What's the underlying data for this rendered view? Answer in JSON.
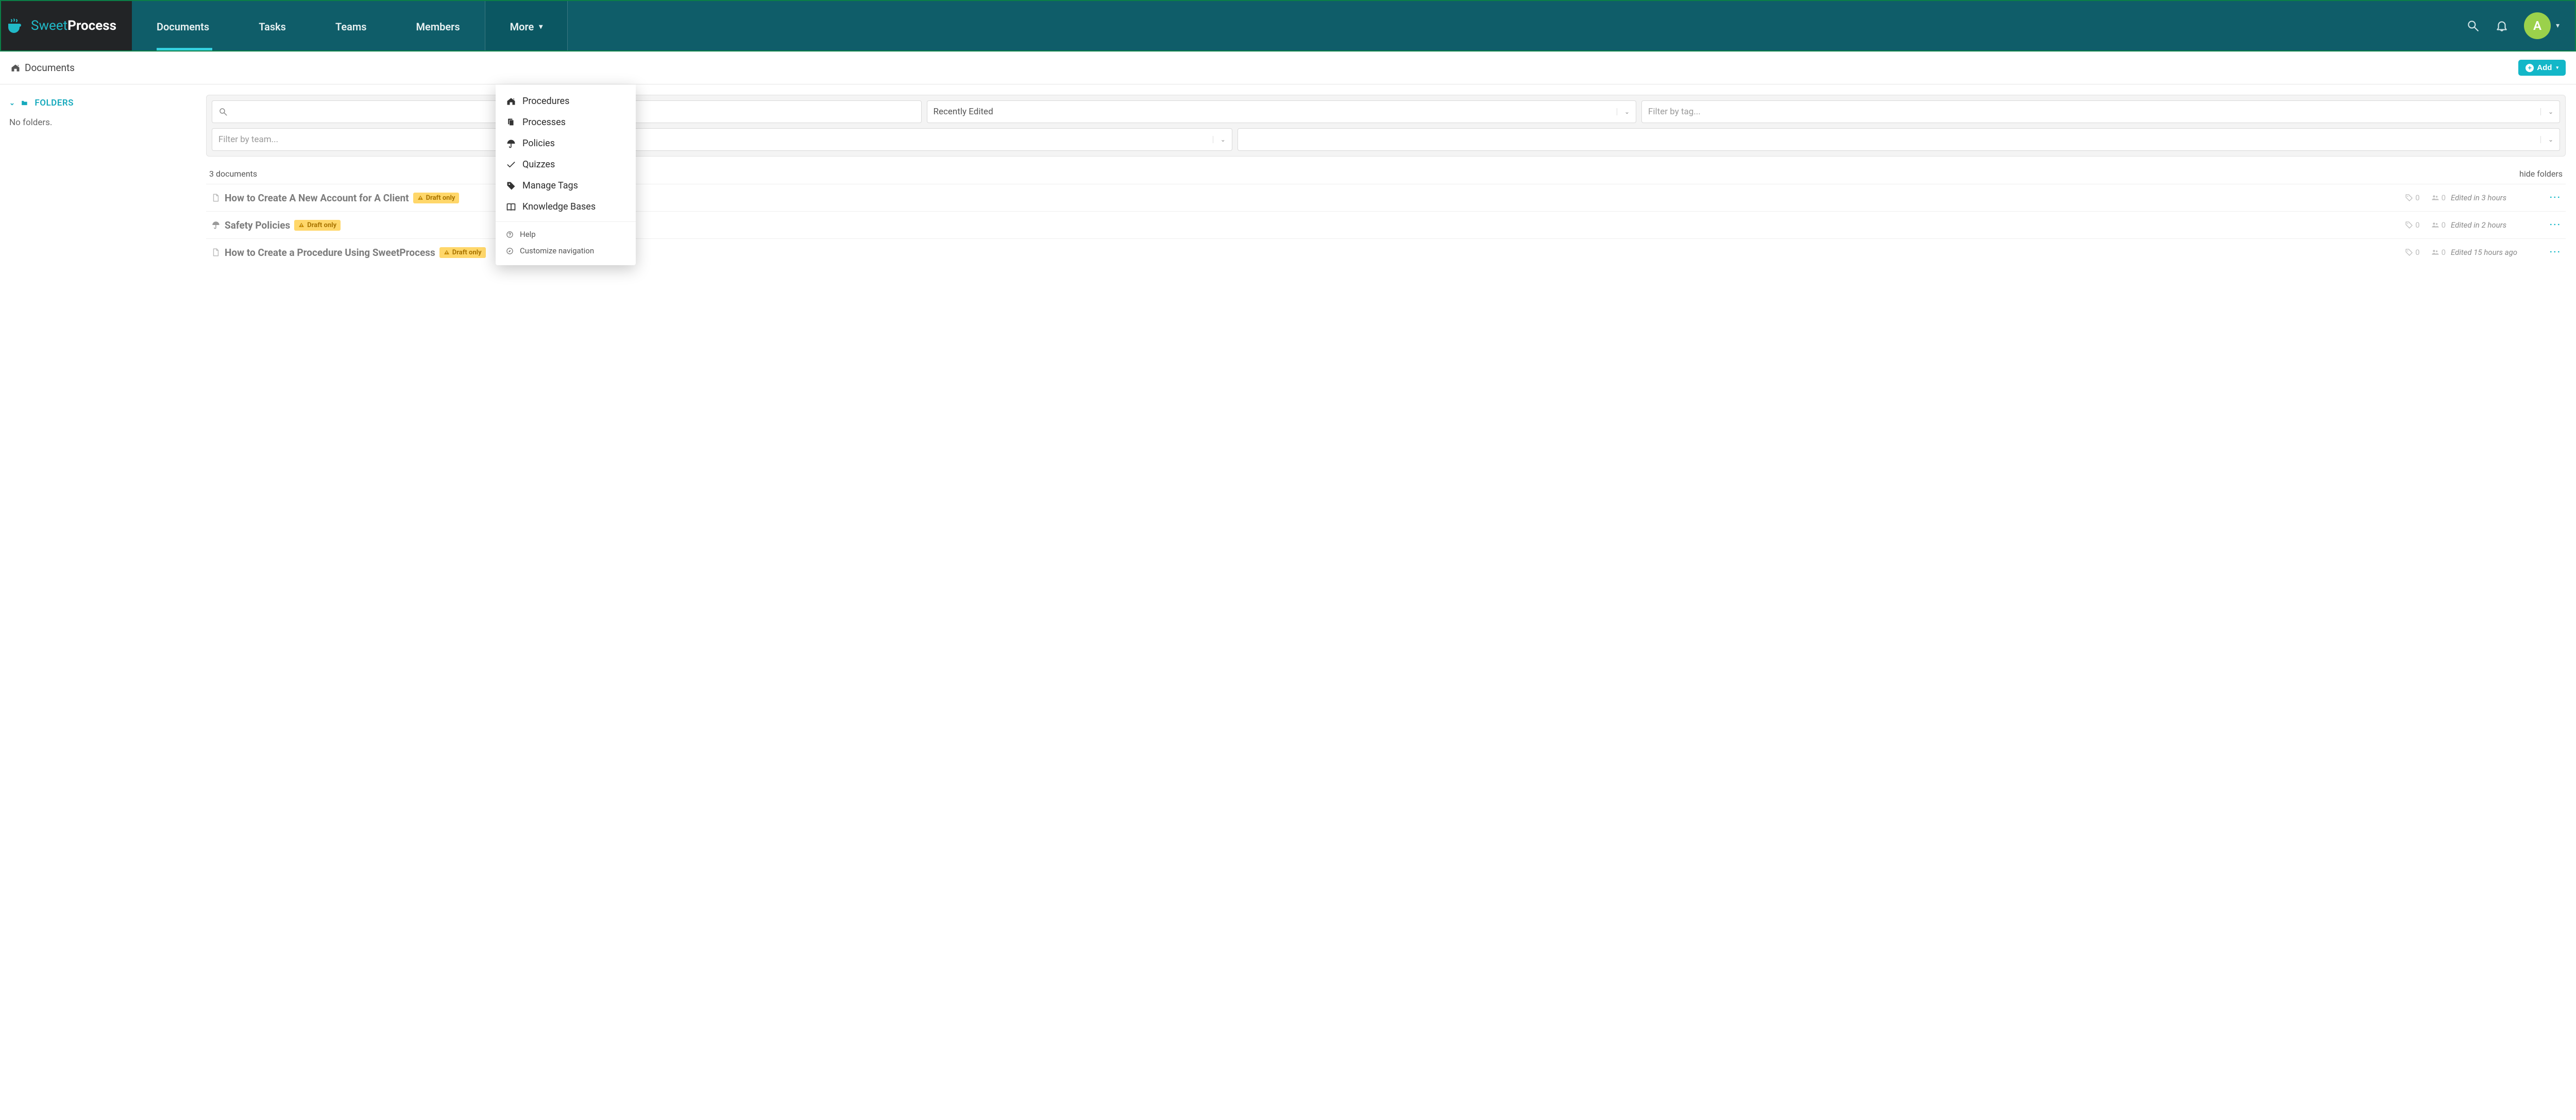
{
  "brand": {
    "part1": "Sweet",
    "part2": "Process"
  },
  "nav": {
    "documents": "Documents",
    "tasks": "Tasks",
    "teams": "Teams",
    "members": "Members",
    "more": "More"
  },
  "avatar_initial": "A",
  "breadcrumb": {
    "title": "Documents"
  },
  "add_button": "Add",
  "sidebar": {
    "folders_label": "FOLDERS",
    "no_folders": "No folders."
  },
  "filters": {
    "search_placeholder": "",
    "sort_value": "Recently Edited",
    "tag_placeholder": "Filter by tag...",
    "team_placeholder": "Filter by team..."
  },
  "count_text": "3 documents",
  "hide_folders": "hide folders",
  "more_menu": {
    "procedures": "Procedures",
    "processes": "Processes",
    "policies": "Policies",
    "quizzes": "Quizzes",
    "manage_tags": "Manage Tags",
    "knowledge_bases": "Knowledge Bases",
    "help": "Help",
    "customize_nav": "Customize navigation"
  },
  "docs": [
    {
      "title": "How to Create A New Account for A Client",
      "badge": "Draft only",
      "tags": "0",
      "people": "0",
      "edited": "Edited in 3 hours",
      "type": "document"
    },
    {
      "title": "Safety Policies",
      "badge": "Draft only",
      "tags": "0",
      "people": "0",
      "edited": "Edited in 2 hours",
      "type": "policy"
    },
    {
      "title": "How to Create a Procedure Using SweetProcess",
      "badge": "Draft only",
      "tags": "0",
      "people": "0",
      "edited": "Edited 15 hours ago",
      "type": "document"
    }
  ]
}
